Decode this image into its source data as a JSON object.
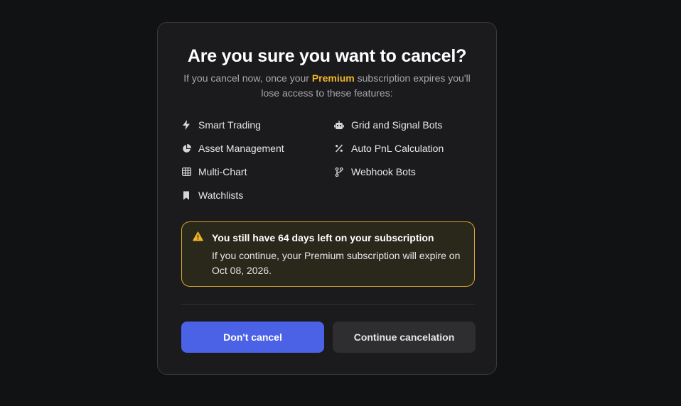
{
  "dialog": {
    "title": "Are you sure you want to cancel?",
    "subtitle_before": "If you cancel now, once your ",
    "subtitle_highlight": "Premium",
    "subtitle_after": " subscription expires you'll lose access to these features:",
    "highlight_color": "#f0b429"
  },
  "features": [
    {
      "label": "Smart Trading",
      "icon": "lightning-icon"
    },
    {
      "label": "Grid and Signal Bots",
      "icon": "robot-icon"
    },
    {
      "label": "Asset Management",
      "icon": "pie-chart-icon"
    },
    {
      "label": "Auto PnL Calculation",
      "icon": "percent-icon"
    },
    {
      "label": "Multi-Chart",
      "icon": "grid-icon"
    },
    {
      "label": "Webhook Bots",
      "icon": "branch-icon"
    },
    {
      "label": "Watchlists",
      "icon": "bookmark-icon"
    }
  ],
  "alert": {
    "icon": "warning-icon",
    "title": "You still have 64 days left on your subscription",
    "text": "If you continue, your Premium subscription will expire on Oct 08, 2026.",
    "border_color": "#d9a72e"
  },
  "buttons": {
    "primary_label": "Don't cancel",
    "secondary_label": "Continue cancelation",
    "primary_color": "#4b62e6"
  }
}
